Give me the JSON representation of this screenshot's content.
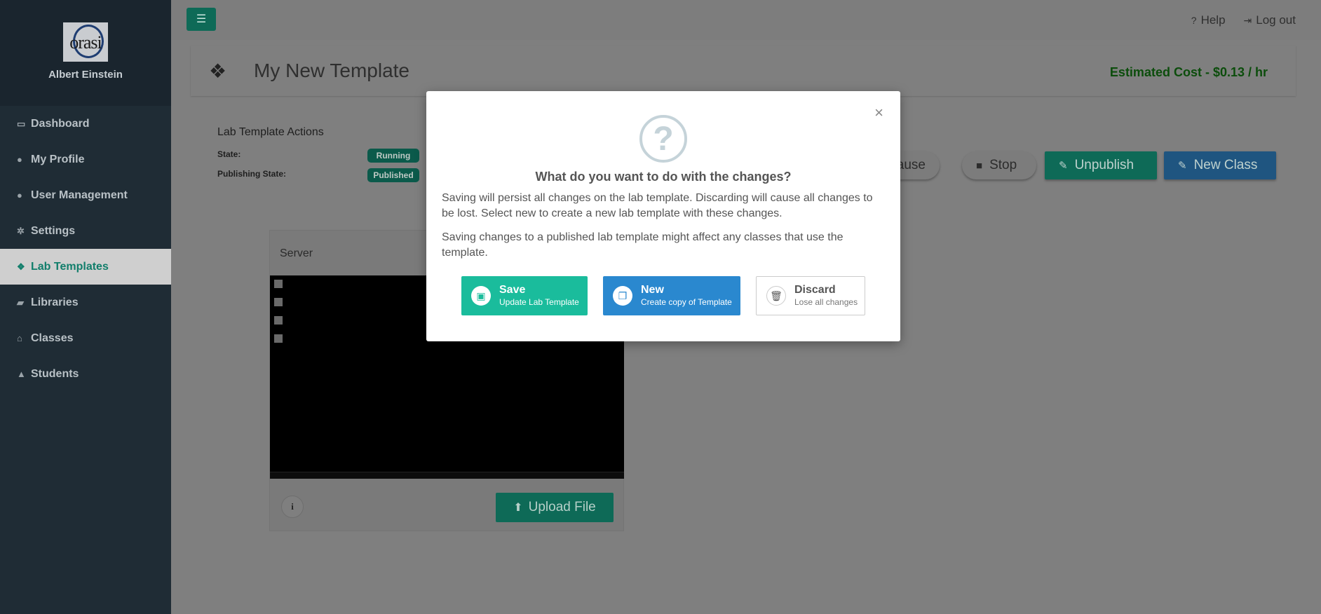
{
  "user": {
    "name": "Albert Einstein",
    "logo_text": "orasi"
  },
  "sidebar": {
    "items": [
      {
        "label": "Dashboard",
        "icon": "monitor-icon",
        "glyph": "▭"
      },
      {
        "label": "My Profile",
        "icon": "user-icon",
        "glyph": "●"
      },
      {
        "label": "User Management",
        "icon": "users-icon",
        "glyph": "●"
      },
      {
        "label": "Settings",
        "icon": "gear-icon",
        "glyph": "✲"
      },
      {
        "label": "Lab Templates",
        "icon": "cubes-icon",
        "glyph": "❖",
        "active": true
      },
      {
        "label": "Libraries",
        "icon": "book-icon",
        "glyph": "▰"
      },
      {
        "label": "Classes",
        "icon": "bank-icon",
        "glyph": "⌂"
      },
      {
        "label": "Students",
        "icon": "graduation-cap-icon",
        "glyph": "▲"
      }
    ]
  },
  "topbar": {
    "help": "Help",
    "logout": "Log out"
  },
  "page": {
    "title": "My New Template",
    "cost": "Estimated Cost - $0.13 / hr"
  },
  "actions": {
    "title": "Lab Template Actions",
    "state_label": "State:",
    "state_value": "Running",
    "publishing_label": "Publishing State:",
    "publishing_value": "Published",
    "pause": "Pause",
    "stop": "Stop",
    "unpublish": "Unpublish",
    "new_class": "New Class"
  },
  "server": {
    "title": "Server",
    "upload": "Upload File",
    "info": "i"
  },
  "modal": {
    "heading": "What do you want to do with the changes?",
    "p1": "Saving will persist all changes on the lab template. Discarding will cause all changes to be lost. Select new to create a new lab template with these changes.",
    "p2": "Saving changes to a published lab template might affect any classes that use the template.",
    "save": {
      "title": "Save",
      "subtitle": "Update Lab Template"
    },
    "new": {
      "title": "New",
      "subtitle": "Create copy of Template"
    },
    "discard": {
      "title": "Discard",
      "subtitle": "Lose all changes"
    }
  },
  "colors": {
    "brand": "#1abc9c",
    "primary": "#2a88cf",
    "sidebar": "#1f2c35"
  }
}
